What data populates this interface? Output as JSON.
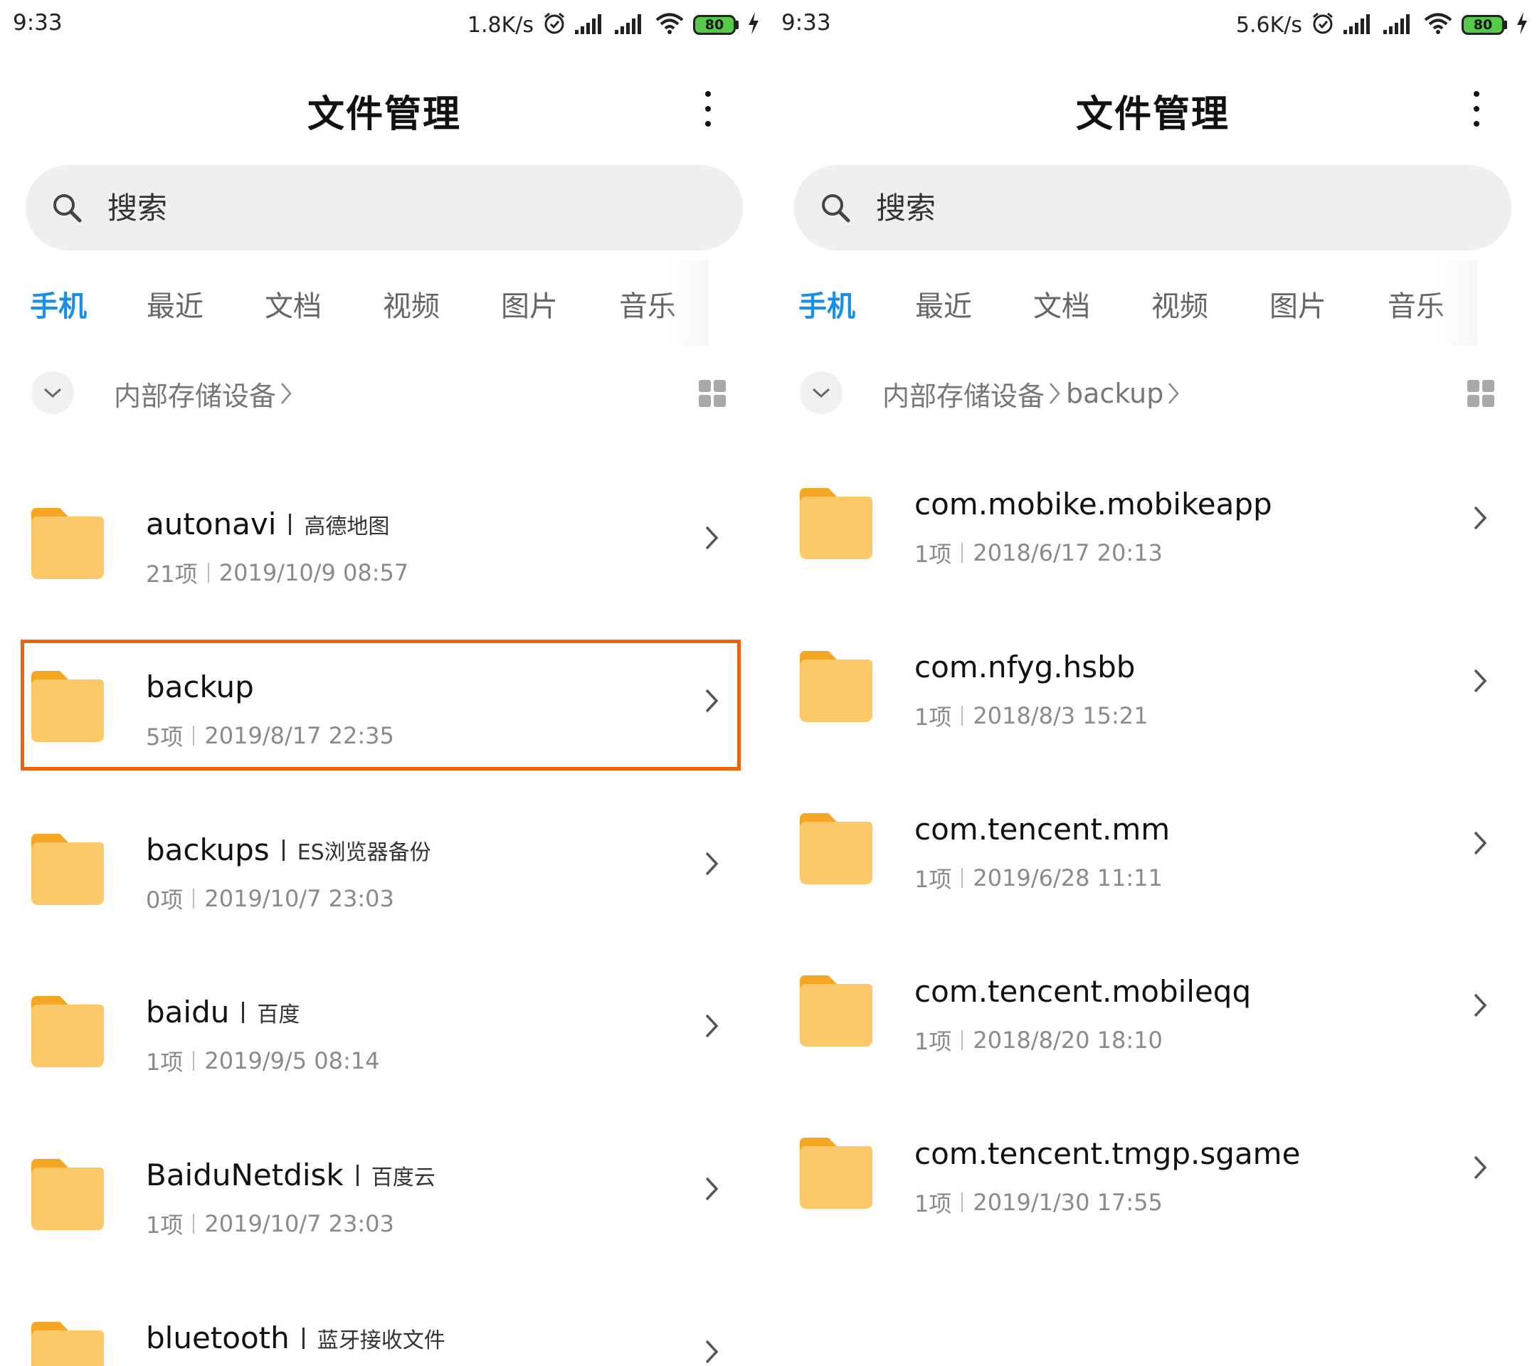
{
  "screens": {
    "left": {
      "status": {
        "time": "9:33",
        "net_speed": "1.8K/s",
        "battery": "80"
      },
      "title": "文件管理",
      "search": {
        "placeholder": "搜索"
      },
      "tabs": [
        "手机",
        "最近",
        "文档",
        "视频",
        "图片",
        "音乐"
      ],
      "active_tab": "手机",
      "breadcrumb": [
        "内部存储设备"
      ],
      "items": [
        {
          "name": "autonavi",
          "alias": "高德地图",
          "count": "21项",
          "date": "2019/10/9 08:57"
        },
        {
          "name": "backup",
          "alias": "",
          "count": "5项",
          "date": "2019/8/17 22:35",
          "highlighted": true
        },
        {
          "name": "backups",
          "alias": "ES浏览器备份",
          "count": "0项",
          "date": "2019/10/7 23:03"
        },
        {
          "name": "baidu",
          "alias": "百度",
          "count": "1项",
          "date": "2019/9/5 08:14"
        },
        {
          "name": "BaiduNetdisk",
          "alias": "百度云",
          "count": "1项",
          "date": "2019/10/7 23:03"
        },
        {
          "name": "bluetooth",
          "alias": "蓝牙接收文件",
          "count": "",
          "date": ""
        }
      ]
    },
    "right": {
      "status": {
        "time": "9:33",
        "net_speed": "5.6K/s",
        "battery": "80"
      },
      "title": "文件管理",
      "search": {
        "placeholder": "搜索"
      },
      "tabs": [
        "手机",
        "最近",
        "文档",
        "视频",
        "图片",
        "音乐"
      ],
      "active_tab": "手机",
      "breadcrumb": [
        "内部存储设备",
        "backup"
      ],
      "items": [
        {
          "name": "com.mobike.mobikeapp",
          "alias": "",
          "count": "1项",
          "date": "2018/6/17 20:13"
        },
        {
          "name": "com.nfyg.hsbb",
          "alias": "",
          "count": "1项",
          "date": "2018/8/3 15:21"
        },
        {
          "name": "com.tencent.mm",
          "alias": "",
          "count": "1项",
          "date": "2019/6/28 11:11"
        },
        {
          "name": "com.tencent.mobileqq",
          "alias": "",
          "count": "1项",
          "date": "2018/8/20 18:10"
        },
        {
          "name": "com.tencent.tmgp.sgame",
          "alias": "",
          "count": "1项",
          "date": "2019/1/30 17:55"
        }
      ]
    }
  },
  "icons": {
    "status": [
      "alarm-icon",
      "signal-icon",
      "signal-icon",
      "wifi-icon",
      "battery-icon",
      "charging-icon"
    ],
    "header": "more-vertical-icon",
    "search": "search-icon",
    "collapse": "chevron-down-icon",
    "view": "grid-view-icon",
    "folder": "folder-icon",
    "row": "chevron-right-icon"
  },
  "colors": {
    "accent": "#1a8fe8",
    "folder_body": "#fdc86a",
    "folder_tab": "#f5a623",
    "highlight": "#e8650e"
  }
}
